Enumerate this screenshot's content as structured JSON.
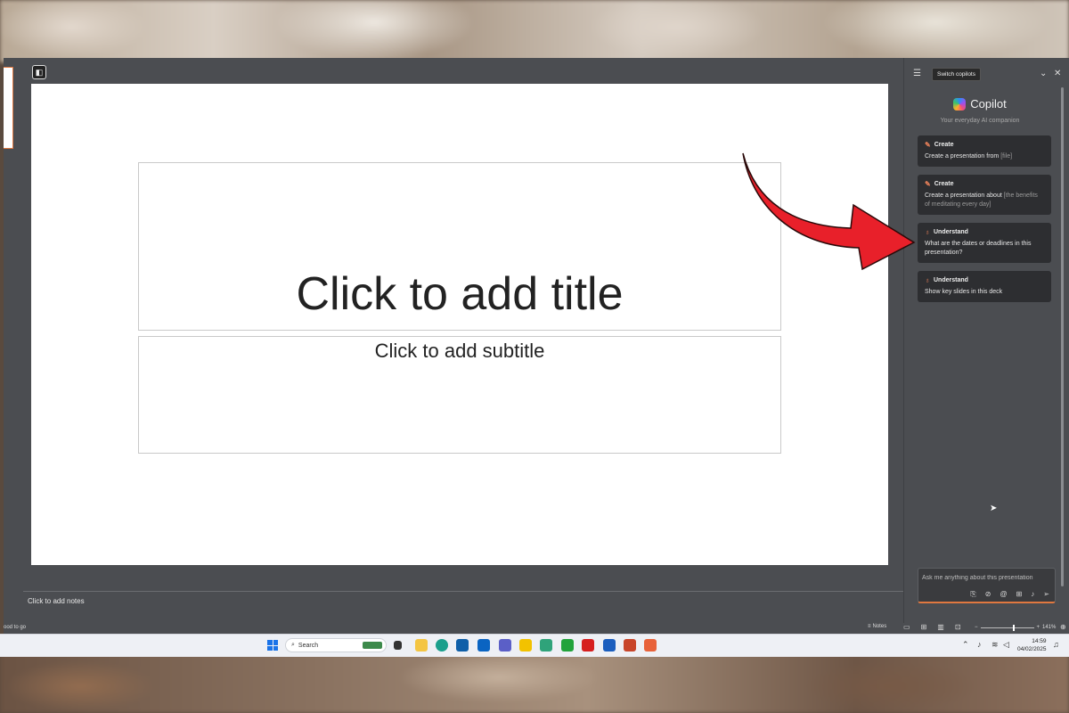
{
  "slide": {
    "title_placeholder": "Click to add title",
    "subtitle_placeholder": "Click to add subtitle"
  },
  "notes": {
    "placeholder": "Click to add notes"
  },
  "status_bar": {
    "left_text": "ood to go",
    "notes_label": "Notes",
    "zoom_level": "141%"
  },
  "copilot": {
    "tooltip": "Switch copilots",
    "name": "Copilot",
    "tagline": "Your everyday AI companion",
    "suggestions": [
      {
        "category": "Create",
        "text": "Create a presentation from",
        "hint": "[file]",
        "icon": "pen-icon"
      },
      {
        "category": "Create",
        "text": "Create a presentation about",
        "hint": "[the benefits of meditating every day]",
        "icon": "pen-icon"
      },
      {
        "category": "Understand",
        "text": "What are the dates or deadlines in this presentation?",
        "hint": "",
        "icon": "lightbulb-icon"
      },
      {
        "category": "Understand",
        "text": "Show key slides in this deck",
        "hint": "",
        "icon": "lightbulb-icon"
      }
    ],
    "input_placeholder": "Ask me anything about this presentation"
  },
  "taskbar": {
    "search_label": "Search",
    "time": "14:59",
    "date": "04/02/2025"
  },
  "colors": {
    "accent": "#e07840",
    "arrow": "#e8202a",
    "window_bg": "#4b4d51",
    "card_bg": "#2d2e31"
  }
}
